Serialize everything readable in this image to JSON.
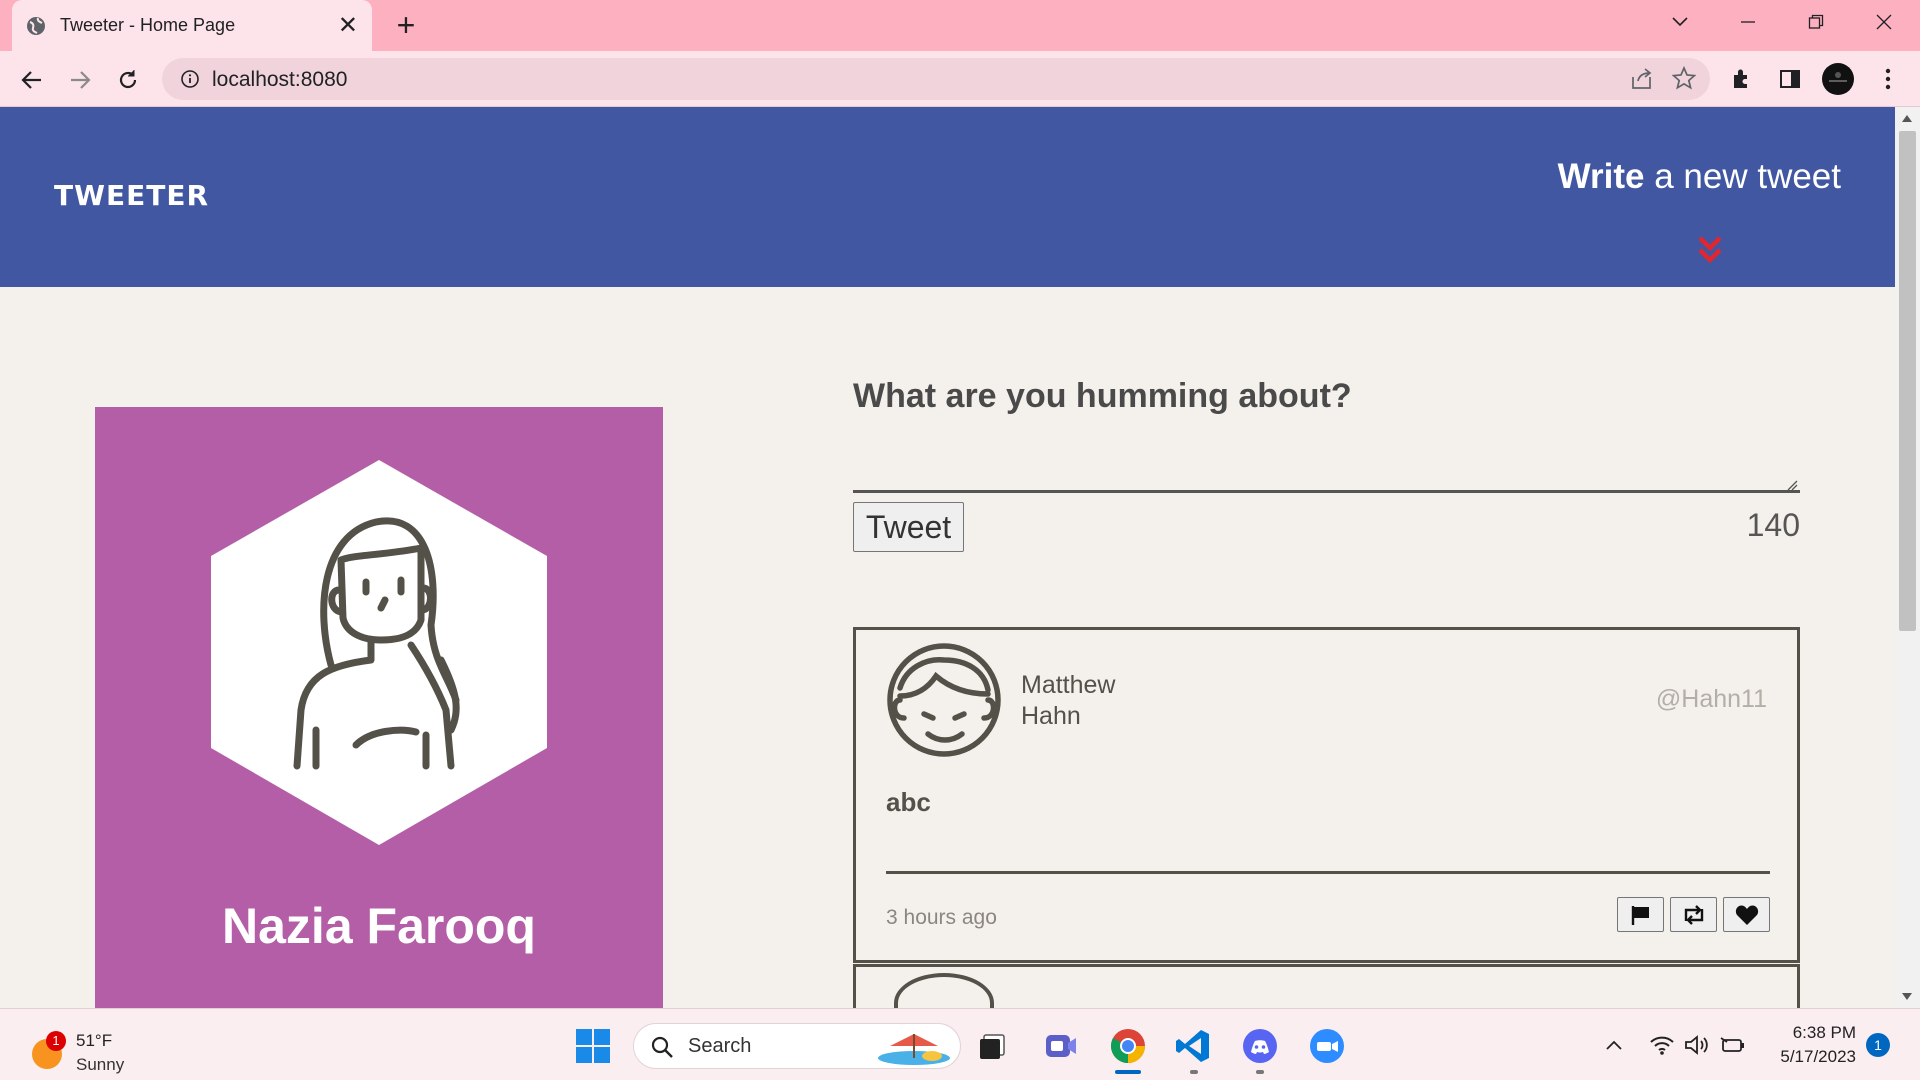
{
  "browser": {
    "tab_title": "Tweeter - Home Page",
    "url": "localhost:8080",
    "new_tab_symbol": "+",
    "close_symbol": "✕"
  },
  "nav": {
    "brand": "TWEETER",
    "write_bold": "Write",
    "write_rest": " a new tweet",
    "chevron_color": "#e3262d"
  },
  "profile": {
    "name": "Nazia Farooq",
    "background_color": "#b35ea6"
  },
  "compose": {
    "heading": "What are you humming about?",
    "textarea_value": "",
    "button_label": "Tweet",
    "counter": "140"
  },
  "tweets": [
    {
      "name": "Matthew Hahn",
      "handle": "@Hahn11",
      "content": "abc",
      "time": "3 hours ago",
      "actions": [
        "flag-icon",
        "retweet-icon",
        "heart-icon"
      ]
    }
  ],
  "taskbar": {
    "weather_temp": "51°F",
    "weather_condition": "Sunny",
    "weather_badge": "1",
    "search_label": "Search",
    "clock_time": "6:38 PM",
    "clock_date": "5/17/2023",
    "notification_count": "1"
  },
  "colors": {
    "nav_bg": "#4157a2",
    "page_bg": "#f4f1ec",
    "tab_strip": "#fdb0c0"
  }
}
